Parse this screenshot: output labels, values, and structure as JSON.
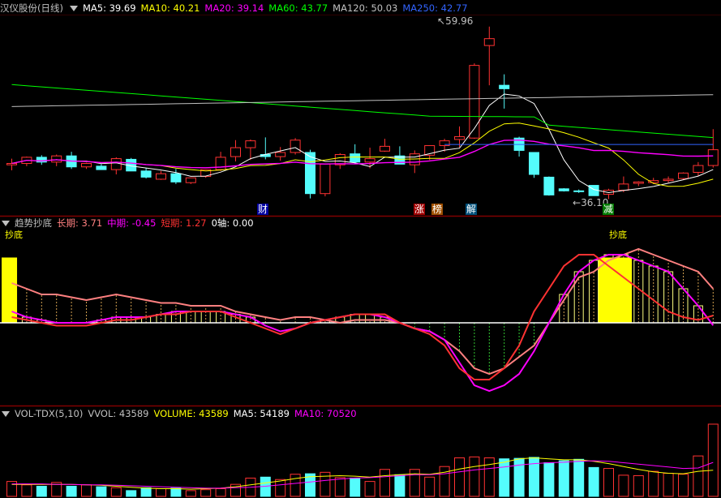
{
  "colors": {
    "up": "#ff3232",
    "down": "#54fcfc",
    "ma5": "#ffffff",
    "ma10": "#ffff00",
    "ma20": "#ff00ff",
    "ma60": "#00ff00",
    "ma120": "#c0c0c0",
    "ma250": "#3264ff",
    "grid": "#800000",
    "zero": "#ffffff",
    "bar_long": "#ff8080"
  },
  "header": {
    "title": "汉仪股份(日线)",
    "ma5": "MA5: 39.69",
    "ma10": "MA10: 40.21",
    "ma20": "MA20: 39.14",
    "ma60": "MA60: 43.77",
    "ma120": "MA120: 50.03",
    "ma250": "MA250: 42.77"
  },
  "price_annotations": {
    "high": "59.96",
    "low": "36.10"
  },
  "event_tags": [
    "财",
    "涨",
    "榜",
    "解",
    "减"
  ],
  "indicator": {
    "name": "趋势抄底",
    "long": "长期: 3.71",
    "mid": "中期: -0.45",
    "short": "短期: 1.27",
    "axis": "0轴: 0.00",
    "signal": "抄底"
  },
  "volume": {
    "name": "VOL-TDX(5,10)",
    "vvol": "VVOL: 43589",
    "volume": "VOLUME: 43589",
    "ma5": "MA5: 54189",
    "ma10": "MA10: 70520"
  },
  "chart_data": [
    {
      "type": "candlestick",
      "title": "汉仪股份(日线)",
      "candles": [
        [
          39.8,
          40.7,
          39.0,
          40.0
        ],
        [
          40.0,
          41.0,
          39.6,
          40.9
        ],
        [
          40.9,
          41.2,
          39.8,
          40.2
        ],
        [
          40.2,
          41.3,
          39.6,
          41.1
        ],
        [
          41.1,
          41.7,
          39.2,
          39.5
        ],
        [
          39.5,
          40.1,
          39.2,
          40.0
        ],
        [
          39.6,
          39.9,
          39.1,
          39.1
        ],
        [
          39.1,
          40.9,
          38.4,
          40.7
        ],
        [
          40.6,
          40.8,
          38.9,
          38.9
        ],
        [
          38.9,
          39.3,
          37.8,
          38.0
        ],
        [
          37.7,
          38.9,
          37.6,
          38.5
        ],
        [
          38.5,
          39.2,
          37.0,
          37.3
        ],
        [
          37.2,
          37.9,
          37.0,
          37.9
        ],
        [
          38.1,
          39.1,
          37.9,
          39.1
        ],
        [
          39.1,
          41.7,
          38.9,
          40.9
        ],
        [
          41.0,
          43.4,
          40.3,
          42.3
        ],
        [
          42.3,
          43.5,
          40.5,
          43.3
        ],
        [
          41.3,
          43.8,
          40.6,
          41.0
        ],
        [
          41.0,
          42.4,
          40.4,
          41.6
        ],
        [
          41.6,
          43.7,
          41.3,
          43.4
        ],
        [
          41.6,
          42.0,
          34.9,
          35.6
        ],
        [
          35.6,
          40.0,
          35.2,
          39.9
        ],
        [
          39.8,
          41.5,
          39.2,
          41.3
        ],
        [
          41.4,
          42.8,
          40.0,
          40.2
        ],
        [
          40.2,
          42.3,
          39.3,
          40.7
        ],
        [
          41.8,
          43.6,
          41.7,
          42.5
        ],
        [
          41.1,
          42.5,
          40.4,
          39.9
        ],
        [
          39.8,
          41.9,
          38.6,
          41.4
        ],
        [
          41.2,
          42.3,
          40.5,
          42.6
        ],
        [
          42.6,
          43.6,
          41.7,
          43.3
        ],
        [
          43.5,
          45.4,
          42.4,
          43.9
        ],
        [
          43.7,
          54.6,
          43.6,
          54.3
        ],
        [
          57.2,
          59.96,
          51.4,
          58.2
        ],
        [
          51.4,
          53.0,
          48.0,
          50.9
        ],
        [
          43.7,
          43.9,
          41.0,
          41.9
        ],
        [
          41.6,
          41.6,
          37.9,
          38.4
        ],
        [
          38.0,
          38.1,
          35.3,
          35.4
        ],
        [
          36.3,
          36.4,
          35.9,
          36.0
        ],
        [
          36.0,
          36.2,
          35.7,
          35.9
        ],
        [
          36.8,
          36.8,
          35.3,
          35.3
        ],
        [
          35.5,
          36.3,
          34.8,
          36.1
        ],
        [
          36.1,
          38.1,
          35.8,
          37.0
        ],
        [
          37.1,
          37.4,
          36.7,
          37.3
        ],
        [
          37.2,
          37.9,
          37.0,
          37.5
        ],
        [
          37.5,
          38.1,
          37.2,
          37.7
        ],
        [
          37.8,
          38.7,
          37.6,
          38.6
        ],
        [
          38.7,
          40.2,
          38.2,
          39.7
        ],
        [
          39.7,
          45.0,
          39.4,
          42.0
        ]
      ],
      "ma": {
        "MA5": 39.69,
        "MA10": 40.21,
        "MA20": 39.14,
        "MA60": 43.77,
        "MA120": 50.03,
        "MA250": 42.77
      },
      "annotations": [
        "59.96",
        "36.10"
      ]
    },
    {
      "type": "line",
      "title": "趋势抄底",
      "series": [
        {
          "name": "长期",
          "values": [
            7,
            6,
            5,
            5,
            4.5,
            4,
            4.5,
            5,
            4.5,
            4,
            3.5,
            3.5,
            3,
            3,
            3,
            2,
            1.5,
            1,
            0.5,
            1,
            1,
            0.5,
            0,
            0.5,
            0.5,
            0.5,
            0,
            -1,
            -1.5,
            -3,
            -5,
            -8,
            -9,
            -8,
            -6,
            -4,
            0,
            4,
            8,
            9,
            11,
            12,
            13,
            12,
            11,
            10,
            9,
            6
          ]
        },
        {
          "name": "中期",
          "values": [
            2,
            1,
            0.5,
            0,
            0,
            0,
            0.5,
            1,
            1,
            1,
            1.5,
            2,
            2,
            2,
            2,
            1.5,
            1,
            -0.5,
            -1.5,
            -1,
            0,
            0.5,
            1,
            1.5,
            1.5,
            1,
            0,
            -1,
            -1.5,
            -3,
            -7,
            -11,
            -12,
            -11,
            -9,
            -5,
            0,
            5,
            9,
            11,
            12,
            12,
            11,
            10,
            9,
            6,
            3,
            -0.45
          ]
        },
        {
          "name": "短期",
          "values": [
            1,
            0.5,
            0,
            -0.5,
            -0.5,
            -0.5,
            0,
            0.5,
            0.5,
            1,
            1.5,
            1.5,
            2,
            2,
            2,
            1,
            0,
            -1,
            -2,
            -1,
            0,
            0.5,
            1,
            1.5,
            1.5,
            1.5,
            0,
            -1,
            -2,
            -4,
            -8,
            -10,
            -10,
            -8,
            -4,
            2,
            6,
            10,
            12,
            12,
            10,
            8,
            6,
            4,
            2,
            1,
            0.5,
            1.27
          ]
        }
      ],
      "signal_markers": [
        "抄底",
        "抄底"
      ]
    },
    {
      "type": "bar",
      "title": "VOL-TDX(5,10)",
      "values": [
        31000,
        24000,
        21000,
        29000,
        21000,
        24000,
        20000,
        18000,
        12000,
        18000,
        16000,
        17000,
        12000,
        14000,
        16000,
        25000,
        38000,
        40000,
        35000,
        46000,
        47000,
        50000,
        39000,
        38000,
        31000,
        56000,
        45000,
        56000,
        40000,
        62000,
        80000,
        82000,
        80000,
        78000,
        79000,
        81000,
        70000,
        74000,
        77000,
        60000,
        58000,
        44000,
        43000,
        52000,
        48000,
        46000,
        84000,
        150000
      ],
      "series": [
        {
          "name": "MA5",
          "values": [
            25000,
            25000,
            25000,
            25000,
            25000,
            24000,
            23000,
            21000,
            19000,
            17000,
            16000,
            16000,
            15000,
            16000,
            17000,
            20000,
            24000,
            28000,
            32000,
            37000,
            41000,
            42000,
            43000,
            42000,
            40000,
            43000,
            45000,
            47000,
            46000,
            50000,
            57000,
            62000,
            66000,
            71000,
            78000,
            80000,
            78000,
            76000,
            76000,
            73000,
            68000,
            62000,
            56000,
            51000,
            48000,
            47000,
            52000,
            54189
          ]
        },
        {
          "name": "MA10",
          "values": [
            26000,
            26000,
            26000,
            25000,
            25000,
            24000,
            24000,
            23000,
            22000,
            21000,
            20000,
            19000,
            18000,
            17000,
            17000,
            18000,
            19000,
            21000,
            24000,
            27000,
            30000,
            33000,
            36000,
            38000,
            39000,
            41000,
            43000,
            45000,
            45000,
            47000,
            51000,
            55000,
            58000,
            61000,
            65000,
            68000,
            70000,
            71000,
            73000,
            74000,
            73000,
            70000,
            67000,
            64000,
            61000,
            58000,
            59000,
            70520
          ]
        }
      ]
    }
  ]
}
